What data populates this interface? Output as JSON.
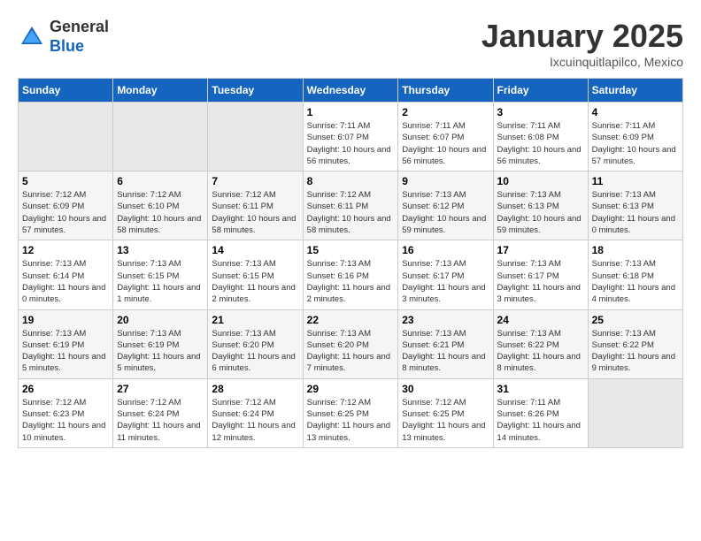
{
  "logo": {
    "general": "General",
    "blue": "Blue"
  },
  "header": {
    "title": "January 2025",
    "subtitle": "Ixcuinquitlapilco, Mexico"
  },
  "weekdays": [
    "Sunday",
    "Monday",
    "Tuesday",
    "Wednesday",
    "Thursday",
    "Friday",
    "Saturday"
  ],
  "weeks": [
    [
      {
        "day": "",
        "empty": true
      },
      {
        "day": "",
        "empty": true
      },
      {
        "day": "",
        "empty": true
      },
      {
        "day": "1",
        "sunrise": "7:11 AM",
        "sunset": "6:07 PM",
        "daylight": "10 hours and 56 minutes."
      },
      {
        "day": "2",
        "sunrise": "7:11 AM",
        "sunset": "6:07 PM",
        "daylight": "10 hours and 56 minutes."
      },
      {
        "day": "3",
        "sunrise": "7:11 AM",
        "sunset": "6:08 PM",
        "daylight": "10 hours and 56 minutes."
      },
      {
        "day": "4",
        "sunrise": "7:11 AM",
        "sunset": "6:09 PM",
        "daylight": "10 hours and 57 minutes."
      }
    ],
    [
      {
        "day": "5",
        "sunrise": "7:12 AM",
        "sunset": "6:09 PM",
        "daylight": "10 hours and 57 minutes."
      },
      {
        "day": "6",
        "sunrise": "7:12 AM",
        "sunset": "6:10 PM",
        "daylight": "10 hours and 58 minutes."
      },
      {
        "day": "7",
        "sunrise": "7:12 AM",
        "sunset": "6:11 PM",
        "daylight": "10 hours and 58 minutes."
      },
      {
        "day": "8",
        "sunrise": "7:12 AM",
        "sunset": "6:11 PM",
        "daylight": "10 hours and 58 minutes."
      },
      {
        "day": "9",
        "sunrise": "7:13 AM",
        "sunset": "6:12 PM",
        "daylight": "10 hours and 59 minutes."
      },
      {
        "day": "10",
        "sunrise": "7:13 AM",
        "sunset": "6:13 PM",
        "daylight": "10 hours and 59 minutes."
      },
      {
        "day": "11",
        "sunrise": "7:13 AM",
        "sunset": "6:13 PM",
        "daylight": "11 hours and 0 minutes."
      }
    ],
    [
      {
        "day": "12",
        "sunrise": "7:13 AM",
        "sunset": "6:14 PM",
        "daylight": "11 hours and 0 minutes."
      },
      {
        "day": "13",
        "sunrise": "7:13 AM",
        "sunset": "6:15 PM",
        "daylight": "11 hours and 1 minute."
      },
      {
        "day": "14",
        "sunrise": "7:13 AM",
        "sunset": "6:15 PM",
        "daylight": "11 hours and 2 minutes."
      },
      {
        "day": "15",
        "sunrise": "7:13 AM",
        "sunset": "6:16 PM",
        "daylight": "11 hours and 2 minutes."
      },
      {
        "day": "16",
        "sunrise": "7:13 AM",
        "sunset": "6:17 PM",
        "daylight": "11 hours and 3 minutes."
      },
      {
        "day": "17",
        "sunrise": "7:13 AM",
        "sunset": "6:17 PM",
        "daylight": "11 hours and 3 minutes."
      },
      {
        "day": "18",
        "sunrise": "7:13 AM",
        "sunset": "6:18 PM",
        "daylight": "11 hours and 4 minutes."
      }
    ],
    [
      {
        "day": "19",
        "sunrise": "7:13 AM",
        "sunset": "6:19 PM",
        "daylight": "11 hours and 5 minutes."
      },
      {
        "day": "20",
        "sunrise": "7:13 AM",
        "sunset": "6:19 PM",
        "daylight": "11 hours and 5 minutes."
      },
      {
        "day": "21",
        "sunrise": "7:13 AM",
        "sunset": "6:20 PM",
        "daylight": "11 hours and 6 minutes."
      },
      {
        "day": "22",
        "sunrise": "7:13 AM",
        "sunset": "6:20 PM",
        "daylight": "11 hours and 7 minutes."
      },
      {
        "day": "23",
        "sunrise": "7:13 AM",
        "sunset": "6:21 PM",
        "daylight": "11 hours and 8 minutes."
      },
      {
        "day": "24",
        "sunrise": "7:13 AM",
        "sunset": "6:22 PM",
        "daylight": "11 hours and 8 minutes."
      },
      {
        "day": "25",
        "sunrise": "7:13 AM",
        "sunset": "6:22 PM",
        "daylight": "11 hours and 9 minutes."
      }
    ],
    [
      {
        "day": "26",
        "sunrise": "7:12 AM",
        "sunset": "6:23 PM",
        "daylight": "11 hours and 10 minutes."
      },
      {
        "day": "27",
        "sunrise": "7:12 AM",
        "sunset": "6:24 PM",
        "daylight": "11 hours and 11 minutes."
      },
      {
        "day": "28",
        "sunrise": "7:12 AM",
        "sunset": "6:24 PM",
        "daylight": "11 hours and 12 minutes."
      },
      {
        "day": "29",
        "sunrise": "7:12 AM",
        "sunset": "6:25 PM",
        "daylight": "11 hours and 13 minutes."
      },
      {
        "day": "30",
        "sunrise": "7:12 AM",
        "sunset": "6:25 PM",
        "daylight": "11 hours and 13 minutes."
      },
      {
        "day": "31",
        "sunrise": "7:11 AM",
        "sunset": "6:26 PM",
        "daylight": "11 hours and 14 minutes."
      },
      {
        "day": "",
        "empty": true
      }
    ]
  ]
}
